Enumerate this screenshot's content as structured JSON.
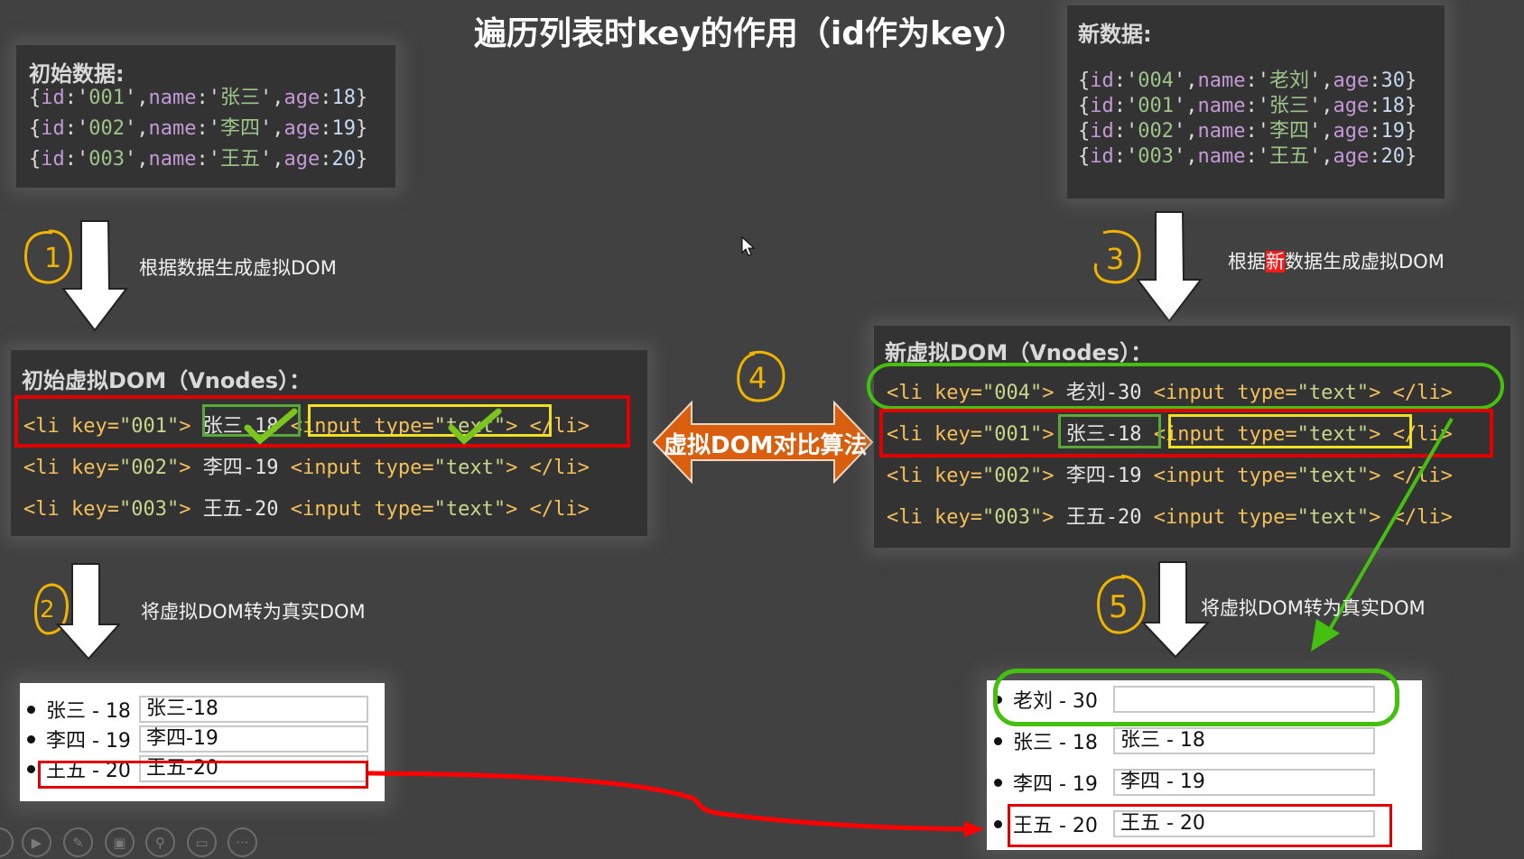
{
  "title": "遍历列表时key的作用（id作为key）",
  "initial_data": {
    "label": "初始数据:",
    "rows": [
      {
        "id": "001",
        "name": "张三",
        "age": "18"
      },
      {
        "id": "002",
        "name": "李四",
        "age": "19"
      },
      {
        "id": "003",
        "name": "王五",
        "age": "20"
      }
    ]
  },
  "new_data": {
    "label": "新数据:",
    "rows": [
      {
        "id": "004",
        "name": "老刘",
        "age": "30"
      },
      {
        "id": "001",
        "name": "张三",
        "age": "18"
      },
      {
        "id": "002",
        "name": "李四",
        "age": "19"
      },
      {
        "id": "003",
        "name": "王五",
        "age": "20"
      }
    ]
  },
  "steps": {
    "s1": {
      "num": "1",
      "text": "根据数据生成虚拟DOM"
    },
    "s2": {
      "num": "2",
      "text": "将虚拟DOM转为真实DOM"
    },
    "s3": {
      "num": "3",
      "text_before": "根据",
      "text_highlight": "新",
      "text_after": "数据生成虚拟DOM"
    },
    "s4": {
      "num": "4",
      "text": "虚拟DOM对比算法"
    },
    "s5": {
      "num": "5",
      "text": "将虚拟DOM转为真实DOM"
    }
  },
  "initial_vdom": {
    "label": "初始虚拟DOM（Vnodes）：",
    "rows": [
      {
        "key": "001",
        "text": "张三-18"
      },
      {
        "key": "002",
        "text": "李四-19"
      },
      {
        "key": "003",
        "text": "王五-20"
      }
    ]
  },
  "new_vdom": {
    "label": "新虚拟DOM（Vnodes）：",
    "rows": [
      {
        "key": "004",
        "text": "老刘-30"
      },
      {
        "key": "001",
        "text": "张三-18"
      },
      {
        "key": "002",
        "text": "李四-19"
      },
      {
        "key": "003",
        "text": "王五-20"
      }
    ]
  },
  "vnode_parts": {
    "li_open": "<li key=",
    "li_close": "</li>",
    "input_open": "<input type=",
    "input_type": "\"text\"",
    "gt": ">"
  },
  "initial_real": [
    {
      "label": "张三 - 18",
      "value": "张三-18"
    },
    {
      "label": "李四 - 19",
      "value": "李四-19"
    },
    {
      "label": "王五 - 20",
      "value": "王五-20"
    }
  ],
  "new_real": [
    {
      "label": "老刘 - 30",
      "value": ""
    },
    {
      "label": "张三 - 18",
      "value": "张三 - 18"
    },
    {
      "label": "李四 - 19",
      "value": "李四 - 19"
    },
    {
      "label": "王五 - 20",
      "value": "王五 - 20"
    }
  ],
  "colors": {
    "highlight_red": "#e00000",
    "highlight_green": "#45c010",
    "highlight_yellow": "#f0e020",
    "circle_orange": "#f0b400",
    "compare_arrow": "#d95f0e"
  },
  "toolbar": [
    "prev-icon",
    "play-icon",
    "pen-icon",
    "slides-icon",
    "zoom-icon",
    "subtitle-icon",
    "more-icon"
  ]
}
